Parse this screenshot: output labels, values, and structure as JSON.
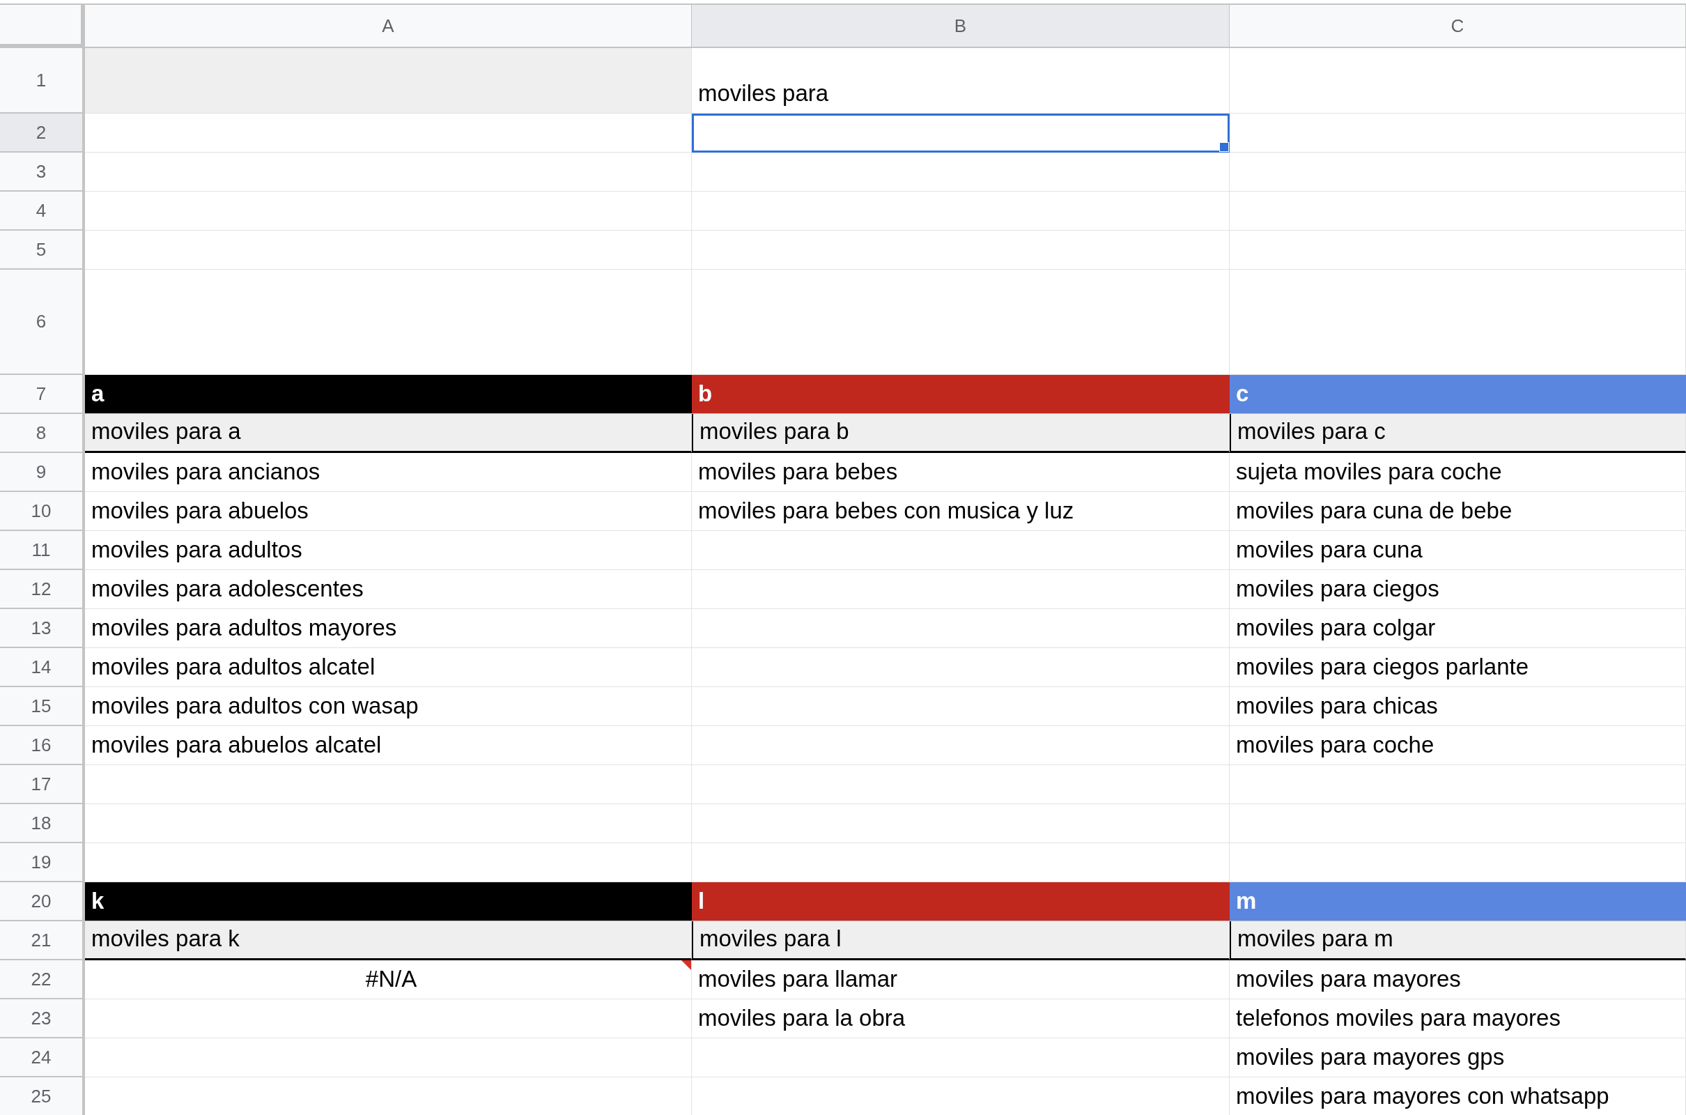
{
  "columns": [
    {
      "label": "A",
      "selected": false
    },
    {
      "label": "B",
      "selected": true
    },
    {
      "label": "C",
      "selected": false
    }
  ],
  "rows": [
    {
      "number": "1",
      "selected": false,
      "cells": [
        {
          "kind": "shaded",
          "selected": false
        },
        {
          "kind": "plain",
          "text": "moviles para",
          "selected": false
        },
        {
          "kind": "blank",
          "selected": false
        }
      ]
    },
    {
      "number": "2",
      "selected": true,
      "cells": [
        {
          "kind": "blank",
          "selected": false
        },
        {
          "kind": "blank",
          "selected": true
        },
        {
          "kind": "blank",
          "selected": false
        }
      ]
    },
    {
      "number": "3",
      "selected": false,
      "cells": [
        {
          "kind": "blank",
          "selected": false
        },
        {
          "kind": "blank",
          "selected": false
        },
        {
          "kind": "blank",
          "selected": false
        }
      ]
    },
    {
      "number": "4",
      "selected": false,
      "cells": [
        {
          "kind": "blank",
          "selected": false
        },
        {
          "kind": "blank",
          "selected": false
        },
        {
          "kind": "blank",
          "selected": false
        }
      ]
    },
    {
      "number": "5",
      "selected": false,
      "cells": [
        {
          "kind": "blank",
          "selected": false
        },
        {
          "kind": "blank",
          "selected": false
        },
        {
          "kind": "blank",
          "selected": false
        }
      ]
    },
    {
      "number": "6",
      "selected": false,
      "cells": [
        {
          "kind": "blank",
          "selected": false
        },
        {
          "kind": "blank",
          "selected": false
        },
        {
          "kind": "blank",
          "selected": false
        }
      ]
    },
    {
      "number": "7",
      "selected": false,
      "cells": [
        {
          "kind": "header",
          "text": "a",
          "color": "#000000",
          "selected": false
        },
        {
          "kind": "header",
          "text": "b",
          "color": "#c0281e",
          "selected": false
        },
        {
          "kind": "header",
          "text": "c",
          "color": "#5b86e0",
          "selected": false
        }
      ]
    },
    {
      "number": "8",
      "selected": false,
      "cells": [
        {
          "kind": "subheader",
          "text": "moviles para a",
          "selected": false
        },
        {
          "kind": "subheader",
          "text": "moviles para b",
          "selected": false
        },
        {
          "kind": "subheader",
          "text": "moviles para c",
          "selected": false
        }
      ]
    },
    {
      "number": "9",
      "selected": false,
      "cells": [
        {
          "kind": "plain",
          "text": "moviles para ancianos",
          "selected": false
        },
        {
          "kind": "plain",
          "text": "moviles para bebes",
          "selected": false
        },
        {
          "kind": "plain",
          "text": "sujeta moviles para coche",
          "selected": false
        }
      ]
    },
    {
      "number": "10",
      "selected": false,
      "cells": [
        {
          "kind": "plain",
          "text": "moviles para abuelos",
          "selected": false
        },
        {
          "kind": "plain",
          "text": "moviles para bebes con musica y luz",
          "selected": false
        },
        {
          "kind": "plain",
          "text": "moviles para cuna de bebe",
          "selected": false
        }
      ]
    },
    {
      "number": "11",
      "selected": false,
      "cells": [
        {
          "kind": "plain",
          "text": "moviles para adultos",
          "selected": false
        },
        {
          "kind": "blank",
          "selected": false
        },
        {
          "kind": "plain",
          "text": "moviles para cuna",
          "selected": false
        }
      ]
    },
    {
      "number": "12",
      "selected": false,
      "cells": [
        {
          "kind": "plain",
          "text": "moviles para adolescentes",
          "selected": false
        },
        {
          "kind": "blank",
          "selected": false
        },
        {
          "kind": "plain",
          "text": "moviles para ciegos",
          "selected": false
        }
      ]
    },
    {
      "number": "13",
      "selected": false,
      "cells": [
        {
          "kind": "plain",
          "text": "moviles para adultos mayores",
          "selected": false
        },
        {
          "kind": "blank",
          "selected": false
        },
        {
          "kind": "plain",
          "text": "moviles para colgar",
          "selected": false
        }
      ]
    },
    {
      "number": "14",
      "selected": false,
      "cells": [
        {
          "kind": "plain",
          "text": "moviles para adultos alcatel",
          "selected": false
        },
        {
          "kind": "blank",
          "selected": false
        },
        {
          "kind": "plain",
          "text": "moviles para ciegos parlante",
          "selected": false
        }
      ]
    },
    {
      "number": "15",
      "selected": false,
      "cells": [
        {
          "kind": "plain",
          "text": "moviles para adultos con wasap",
          "selected": false
        },
        {
          "kind": "blank",
          "selected": false
        },
        {
          "kind": "plain",
          "text": "moviles para chicas",
          "selected": false
        }
      ]
    },
    {
      "number": "16",
      "selected": false,
      "cells": [
        {
          "kind": "plain",
          "text": "moviles para abuelos alcatel",
          "selected": false
        },
        {
          "kind": "blank",
          "selected": false
        },
        {
          "kind": "plain",
          "text": "moviles para coche",
          "selected": false
        }
      ]
    },
    {
      "number": "17",
      "selected": false,
      "cells": [
        {
          "kind": "blank",
          "selected": false
        },
        {
          "kind": "blank",
          "selected": false
        },
        {
          "kind": "blank",
          "selected": false
        }
      ]
    },
    {
      "number": "18",
      "selected": false,
      "cells": [
        {
          "kind": "blank",
          "selected": false
        },
        {
          "kind": "blank",
          "selected": false
        },
        {
          "kind": "blank",
          "selected": false
        }
      ]
    },
    {
      "number": "19",
      "selected": false,
      "cells": [
        {
          "kind": "blank",
          "selected": false
        },
        {
          "kind": "blank",
          "selected": false
        },
        {
          "kind": "blank",
          "selected": false
        }
      ]
    },
    {
      "number": "20",
      "selected": false,
      "cells": [
        {
          "kind": "header",
          "text": "k",
          "color": "#000000",
          "selected": false
        },
        {
          "kind": "header",
          "text": "l",
          "color": "#c0281e",
          "selected": false
        },
        {
          "kind": "header",
          "text": "m",
          "color": "#5b86e0",
          "selected": false
        }
      ]
    },
    {
      "number": "21",
      "selected": false,
      "cells": [
        {
          "kind": "subheader",
          "text": "moviles para k",
          "selected": false
        },
        {
          "kind": "subheader",
          "text": "moviles para l",
          "selected": false
        },
        {
          "kind": "subheader",
          "text": "moviles para m",
          "selected": false
        }
      ]
    },
    {
      "number": "22",
      "selected": false,
      "cells": [
        {
          "kind": "error",
          "text": "#N/A",
          "selected": false
        },
        {
          "kind": "plain",
          "text": "moviles para llamar",
          "selected": false
        },
        {
          "kind": "plain",
          "text": "moviles para mayores",
          "selected": false
        }
      ]
    },
    {
      "number": "23",
      "selected": false,
      "cells": [
        {
          "kind": "blank",
          "selected": false
        },
        {
          "kind": "plain",
          "text": "moviles para la obra",
          "selected": false
        },
        {
          "kind": "plain",
          "text": "telefonos moviles para mayores",
          "selected": false
        }
      ]
    },
    {
      "number": "24",
      "selected": false,
      "cells": [
        {
          "kind": "blank",
          "selected": false
        },
        {
          "kind": "blank",
          "selected": false
        },
        {
          "kind": "plain",
          "text": "moviles para mayores gps",
          "selected": false
        }
      ]
    },
    {
      "number": "25",
      "selected": false,
      "cells": [
        {
          "kind": "blank",
          "selected": false
        },
        {
          "kind": "blank",
          "selected": false
        },
        {
          "kind": "plain",
          "text": "moviles para mayores con whatsapp",
          "selected": false
        }
      ]
    }
  ]
}
